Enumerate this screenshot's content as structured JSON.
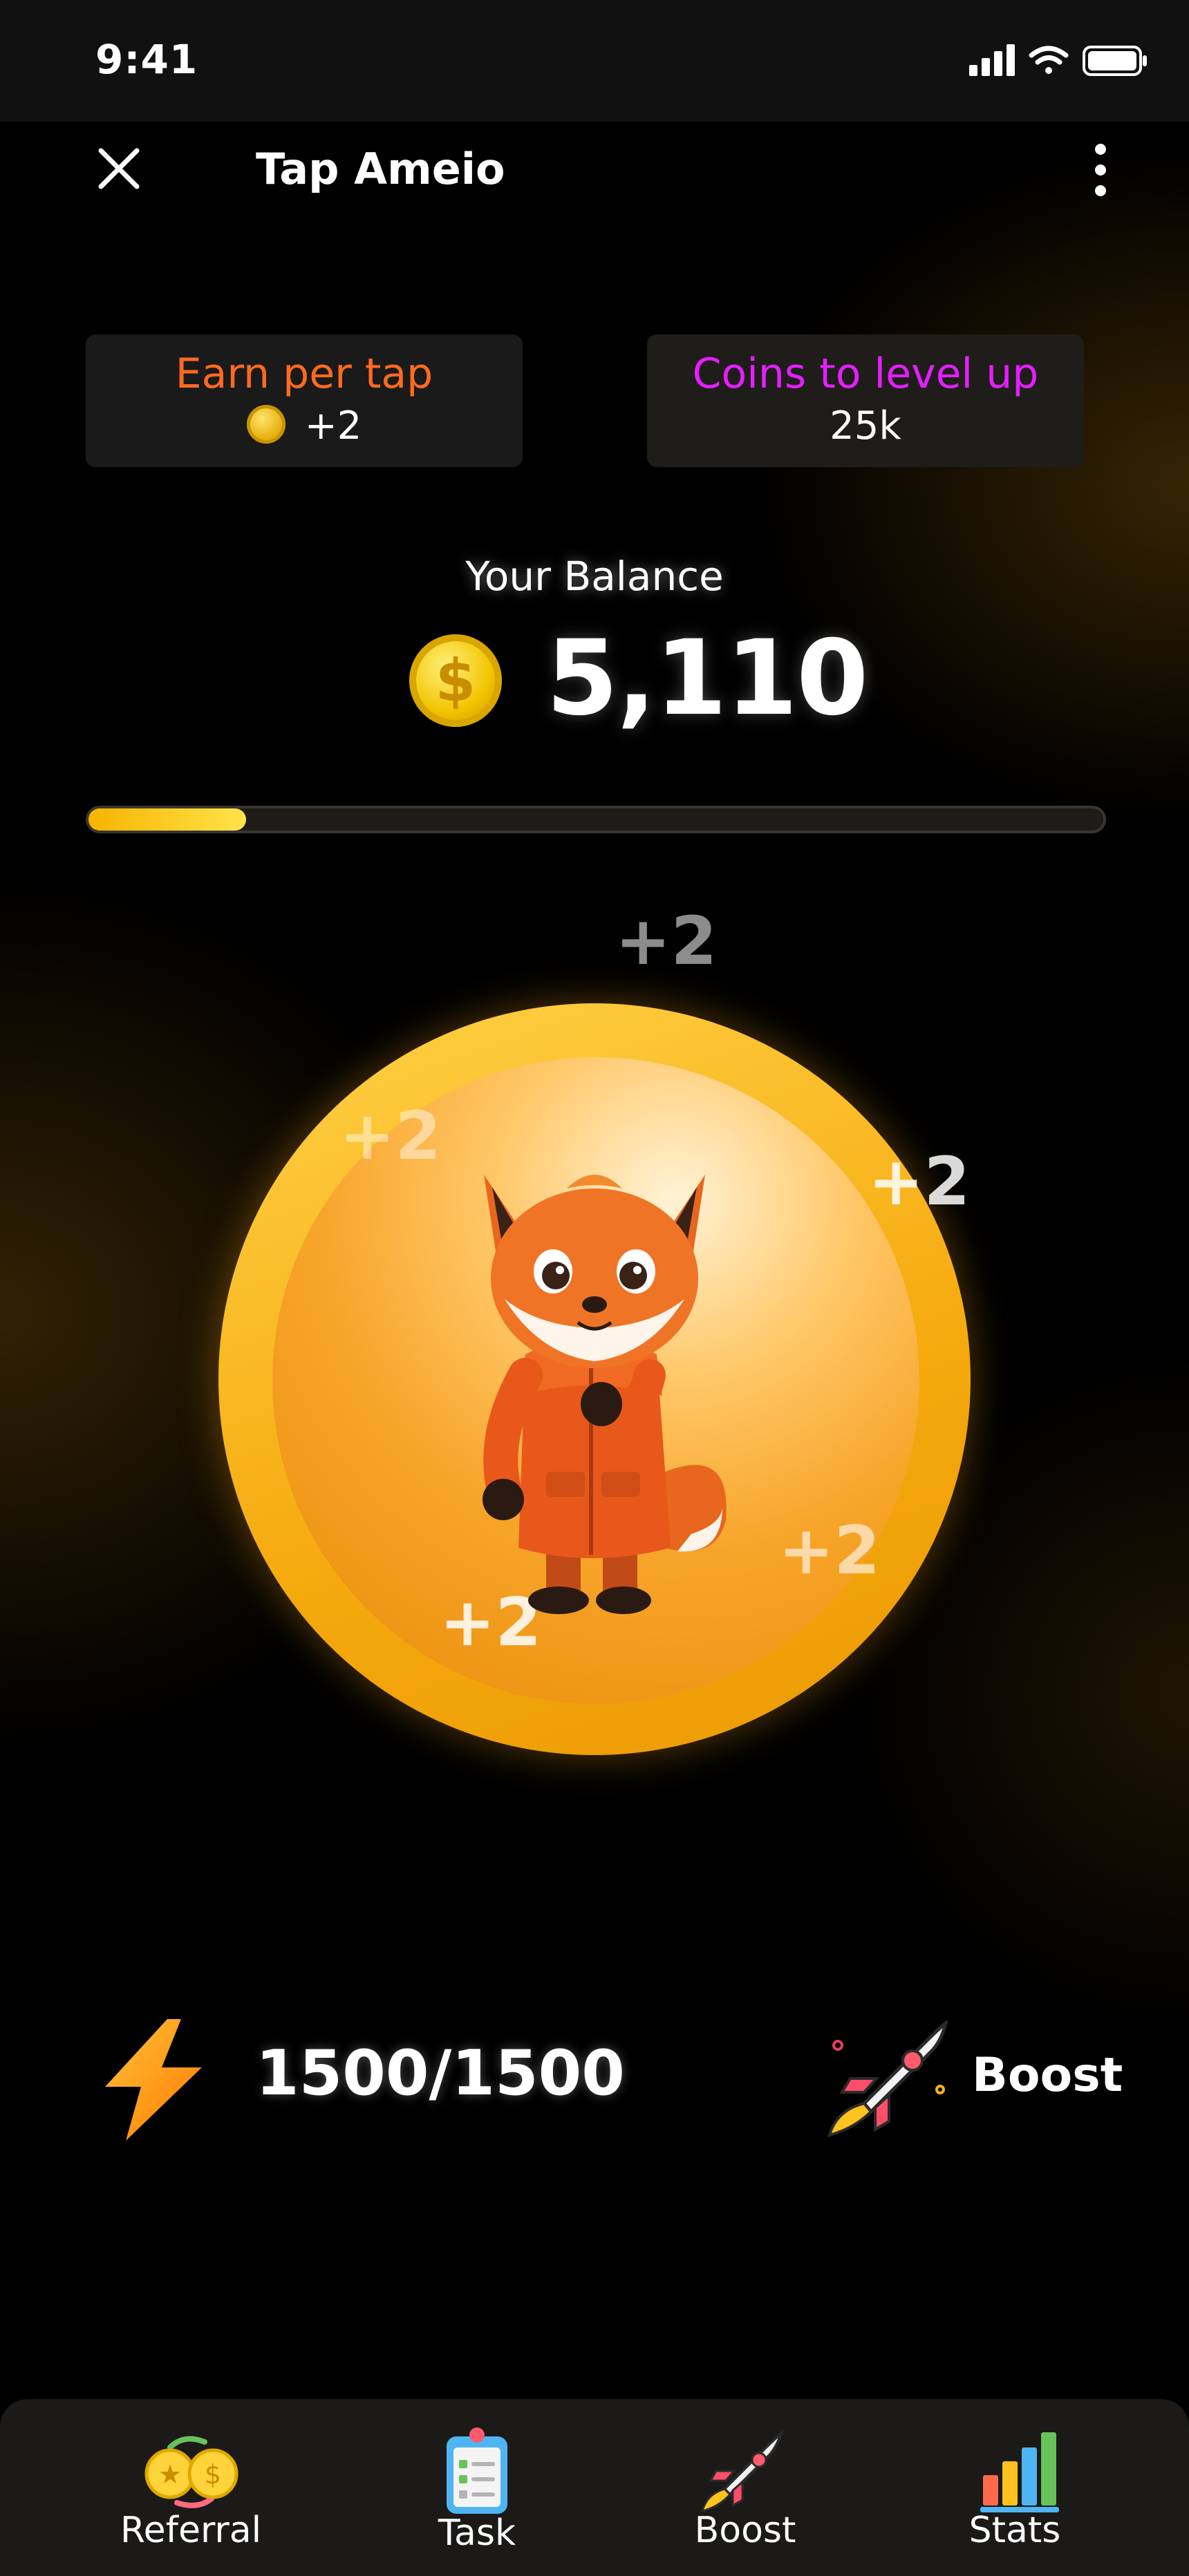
{
  "status_bar": {
    "time": "9:41"
  },
  "header": {
    "title": "Tap Ameio"
  },
  "cards": {
    "earn": {
      "label": "Earn per tap",
      "value": "+2"
    },
    "level": {
      "label": "Coins to level up",
      "value": "25k"
    }
  },
  "balance": {
    "label": "Your Balance",
    "value": "5,110",
    "coin_symbol": "$"
  },
  "progress": {
    "fraction": 0.155
  },
  "tap_area": {
    "floaters": [
      "+2",
      "+2",
      "+2",
      "+2",
      "+2"
    ]
  },
  "energy": {
    "value": "1500/1500"
  },
  "boost": {
    "label": "Boost"
  },
  "nav": {
    "items": [
      {
        "label": "Referral"
      },
      {
        "label": "Task"
      },
      {
        "label": "Boost"
      },
      {
        "label": "Stats"
      }
    ]
  },
  "colors": {
    "earn_label": "#ff6a1f",
    "level_label": "#e51eff",
    "coin": "#f2c400",
    "accent_orange": "#f5a90d"
  }
}
